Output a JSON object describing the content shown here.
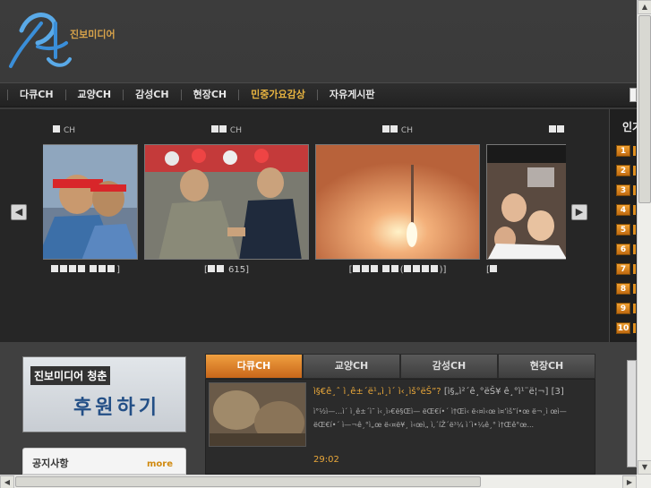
{
  "logo": {
    "hangul": "청춘",
    "sub": "진보미디어"
  },
  "nav": {
    "items": [
      {
        "label": "다큐CH"
      },
      {
        "label": "교양CH"
      },
      {
        "label": "감성CH"
      },
      {
        "label": "현장CH"
      },
      {
        "label": "민중가요감상",
        "active": true
      },
      {
        "label": "자유게시판"
      }
    ]
  },
  "carousel": {
    "prev_icon": "arrow-left-icon",
    "next_icon": "arrow-right-icon",
    "items": [
      {
        "channel": "CH",
        "title": "]"
      },
      {
        "channel": "CH",
        "title": "615]"
      },
      {
        "channel": "CH",
        "title": ")]"
      },
      {
        "channel": "",
        "title": ""
      }
    ]
  },
  "ranking": {
    "title": "인기",
    "numbers": [
      "1",
      "2",
      "3",
      "4",
      "5",
      "6",
      "7",
      "8",
      "9",
      "10"
    ]
  },
  "support": {
    "top_text": "진보미디어 청춘",
    "main_text": "후원하기"
  },
  "notice": {
    "title": "공지사항",
    "more": "more"
  },
  "tabs": [
    {
      "label": "다큐CH",
      "active": true
    },
    {
      "label": "교양CH"
    },
    {
      "label": "감성CH"
    },
    {
      "label": "현장CH"
    }
  ],
  "featured": {
    "title": "ì§€ê¸ˆ ì¸ê±´ë¹„ì¸ì´ ì‹¸ìš°ëŠ”?",
    "meta": "[ì§„ì²´ê¸°ëŠ¥ ê¸°ì¹¨ë¦¬] [3]",
    "description": "ì°½ì—…ì´ ì¸ê±´ì˜ ì‹¸ì›€ë§Œì— ëŒ€í•´ ì†Œì‹ ë‹¤ì‹œ ì¤‘ìš”í•œ ë¬¸ì œì— ëŒ€í•´ ì—¬ê¸°ì„œ ë‹¤ë¥¸ ì‹œì„  ì‚´íŽ´ë³¼ ì´ì•¼ê¸° ì†Œê°œ...",
    "time": "29:02"
  },
  "colors": {
    "accent": "#e8a73a",
    "tab_active": "#e07a26",
    "background": "#3b3b3b"
  }
}
